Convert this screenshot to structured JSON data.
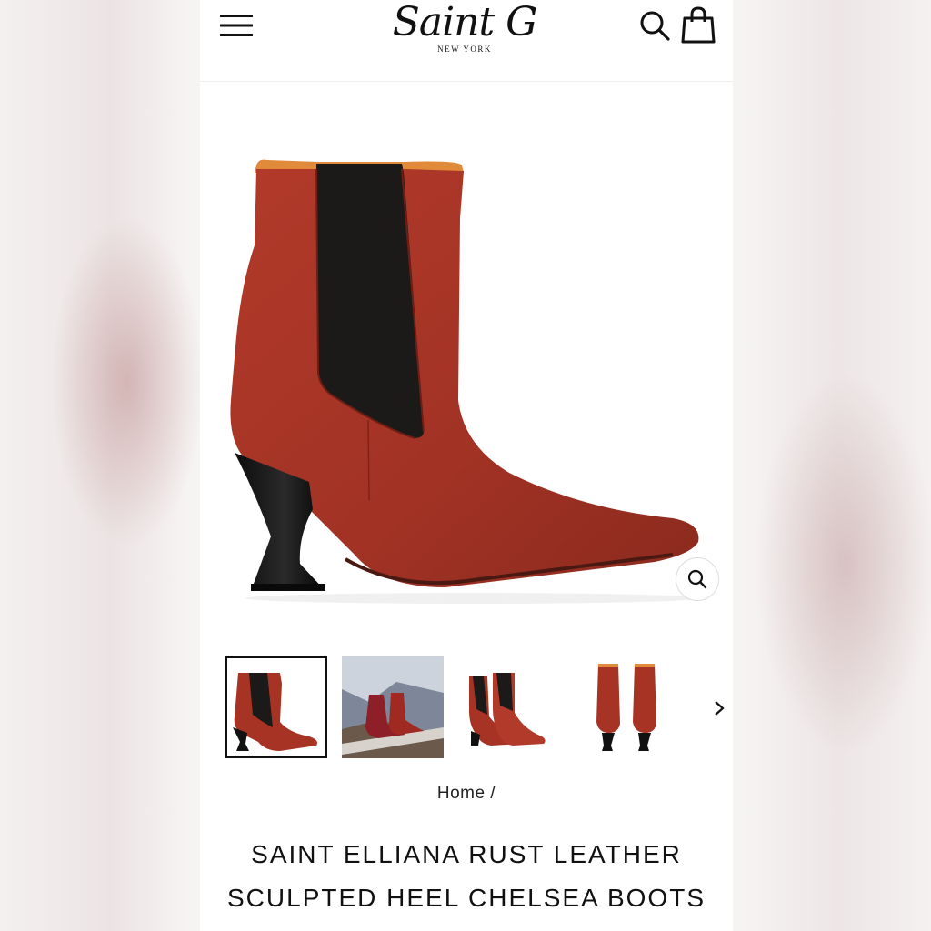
{
  "header": {
    "logo_script": "Saint G",
    "logo_sub": "NEW YORK",
    "icons": [
      "hamburger-menu-icon",
      "search-icon",
      "shopping-bag-icon"
    ]
  },
  "gallery": {
    "zoom_icon": "magnifier-icon",
    "thumbnails": [
      {
        "name": "boot-side-view",
        "active": true
      },
      {
        "name": "boot-lifestyle-snow",
        "active": false
      },
      {
        "name": "boot-pair-front",
        "active": false
      },
      {
        "name": "boot-pair-back",
        "active": false
      }
    ],
    "next_icon": "chevron-right-icon"
  },
  "breadcrumb": {
    "home": "Home",
    "separator": "/"
  },
  "product": {
    "title_line1": "SAINT ELLIANA RUST LEATHER",
    "title_line2": "SCULPTED HEEL CHELSEA BOOTS"
  },
  "colors": {
    "leather": "#a63324",
    "elastic": "#1c1a18",
    "lining": "#e08a3a"
  }
}
